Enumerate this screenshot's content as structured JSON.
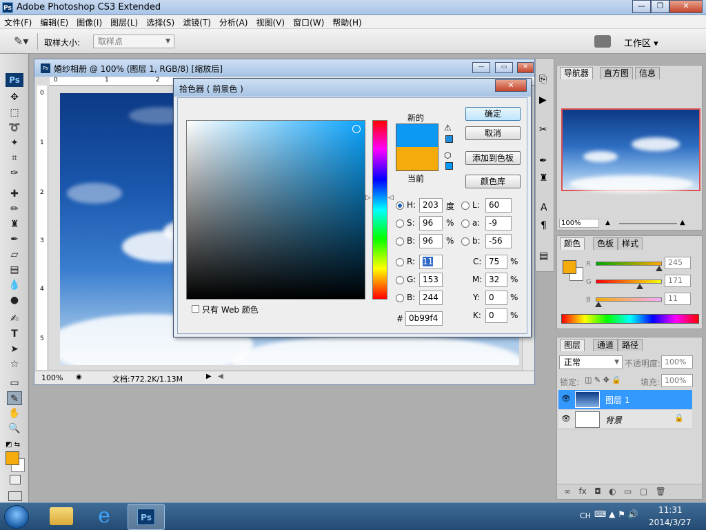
{
  "app": {
    "title": "Adobe Photoshop CS3 Extended",
    "logo": "Ps"
  },
  "menu": [
    "文件(F)",
    "编辑(E)",
    "图像(I)",
    "图层(L)",
    "选择(S)",
    "滤镜(T)",
    "分析(A)",
    "视图(V)",
    "窗口(W)",
    "帮助(H)"
  ],
  "options": {
    "sample_label": "取样大小:",
    "sample_value": "取样点",
    "workspace": "工作区 ▾"
  },
  "document": {
    "title": "婚纱相册 @ 100% (图层 1, RGB/8) [缩放后]",
    "ruler_top": [
      "0",
      "1",
      "2"
    ],
    "ruler_left": [
      "0",
      "1",
      "2",
      "3",
      "4",
      "5"
    ],
    "zoom": "100%",
    "doc_info": "文档:772.2K/1.13M"
  },
  "picker": {
    "title": "拾色器 ( 前景色 )",
    "new_label": "新的",
    "current_label": "当前",
    "new_color": "#0b99f4",
    "current_color": "#f5ab0b",
    "buttons": {
      "ok": "确定",
      "cancel": "取消",
      "add_swatch": "添加到色板",
      "library": "颜色库"
    },
    "web_only": "只有 Web 颜色",
    "hsb": {
      "h_label": "H:",
      "h": "203",
      "h_unit": "度",
      "s_label": "S:",
      "s": "96",
      "s_unit": "%",
      "b_label": "B:",
      "b": "96",
      "b_unit": "%"
    },
    "rgb": {
      "r_label": "R:",
      "r": "11",
      "g_label": "G:",
      "g": "153",
      "b_label": "B:",
      "b": "244"
    },
    "lab": {
      "l_label": "L:",
      "l": "60",
      "a_label": "a:",
      "a": "-9",
      "b_label": "b:",
      "b": "-56"
    },
    "cmyk": {
      "c_label": "C:",
      "c": "75",
      "m_label": "M:",
      "m": "32",
      "y_label": "Y:",
      "y": "0",
      "k_label": "K:",
      "k": "0",
      "unit": "%"
    },
    "hex_label": "#",
    "hex": "0b99f4"
  },
  "navigator": {
    "tabs": [
      "导航器",
      "直方图",
      "信息"
    ],
    "zoom": "100%"
  },
  "color_panel": {
    "tabs": [
      "颜色",
      "色板",
      "样式"
    ],
    "r_label": "R",
    "g_label": "G",
    "b_label": "B",
    "r": "245",
    "g": "171",
    "b": "11",
    "r_level": 0.96,
    "g_level": 0.67,
    "b_level": 0.04
  },
  "layers": {
    "tabs": [
      "图层",
      "通道",
      "路径"
    ],
    "mode": "正常",
    "opacity_label": "不透明度:",
    "opacity": "100%",
    "lock_label": "锁定:",
    "fill_label": "填充:",
    "fill": "100%",
    "items": [
      {
        "name": "图层 1"
      },
      {
        "name": "背景"
      }
    ]
  },
  "taskbar": {
    "lang": "CH",
    "time": "11:31",
    "date": "2014/3/27"
  }
}
